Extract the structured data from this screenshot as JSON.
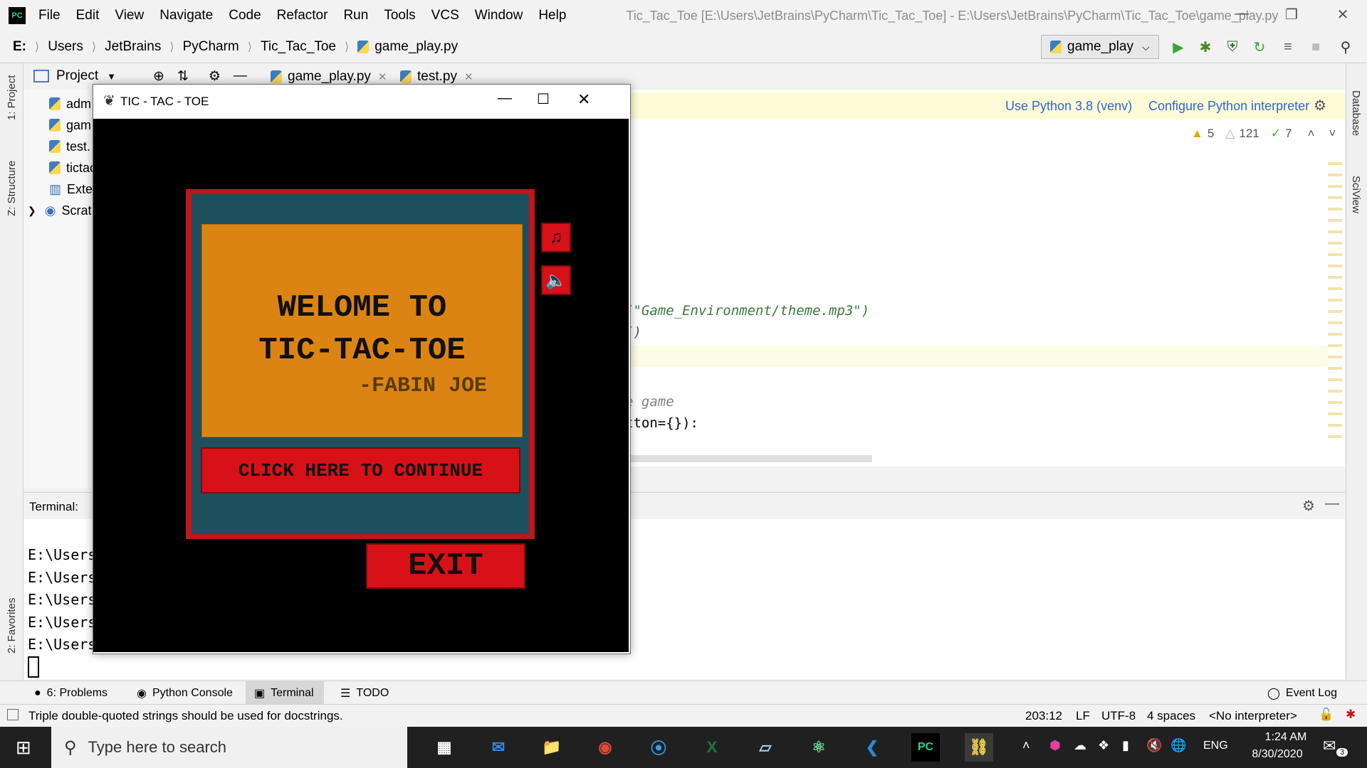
{
  "ide": {
    "menu": [
      "File",
      "Edit",
      "View",
      "Navigate",
      "Code",
      "Refactor",
      "Run",
      "Tools",
      "VCS",
      "Window",
      "Help"
    ],
    "window_title": "Tic_Tac_Toe [E:\\Users\\JetBrains\\PyCharm\\Tic_Tac_Toe] - E:\\Users\\JetBrains\\PyCharm\\Tic_Tac_Toe\\game_play.py",
    "breadcrumbs": [
      "E:",
      "Users",
      "JetBrains",
      "PyCharm",
      "Tic_Tac_Toe",
      "game_play.py"
    ],
    "run_config": "game_play",
    "project_label": "Project",
    "tree_items": [
      "adm",
      "gam",
      "test.",
      "tictac",
      "Exter",
      "Scrat"
    ],
    "tabs": [
      "game_play.py",
      "test.py"
    ],
    "banner_link1": "Use Python 3.8 (venv)",
    "banner_link2": "Configure Python interpreter",
    "inspections": {
      "warnings": "5",
      "weak_warnings": "121",
      "typos": "7"
    },
    "code_lines": [
      "(\"Game_Environment/theme.mp3\")",
      "()",
      "e game",
      "tton={}):"
    ],
    "terminal_label": "Terminal:",
    "terminal_lines": [
      "E:\\Users",
      "E:\\Users",
      "E:\\Users",
      "E:\\Users",
      "E:\\Users"
    ],
    "tool_tabs": [
      "6: Problems",
      "Python Console",
      "Terminal",
      "TODO"
    ],
    "event_log": "Event Log",
    "status_message": "Triple double-quoted strings should be used for docstrings.",
    "status_right": [
      "203:12",
      "LF",
      "UTF-8",
      "4 spaces",
      "<No interpreter>"
    ],
    "left_strip": [
      "1: Project",
      "Z: Structure",
      "2: Favorites"
    ],
    "right_strip": [
      "Database",
      "SciView"
    ]
  },
  "game": {
    "window_title": "TIC - TAC - TOE",
    "welcome_line1": "WELOME TO",
    "welcome_line2": "TIC-TAC-TOE",
    "author": "-FABIN JOE",
    "continue_label": "CLICK HERE TO CONTINUE",
    "exit_label": "EXIT"
  },
  "taskbar": {
    "search_placeholder": "Type here to search",
    "lang": "ENG",
    "time": "1:24 AM",
    "date": "8/30/2020",
    "notifications": "3"
  },
  "colors": {
    "game_frame": "#c0161c",
    "game_teal": "#1d4f5d",
    "game_orange": "#dc8413",
    "button_red": "#d81018",
    "link_blue": "#2f65ca"
  }
}
